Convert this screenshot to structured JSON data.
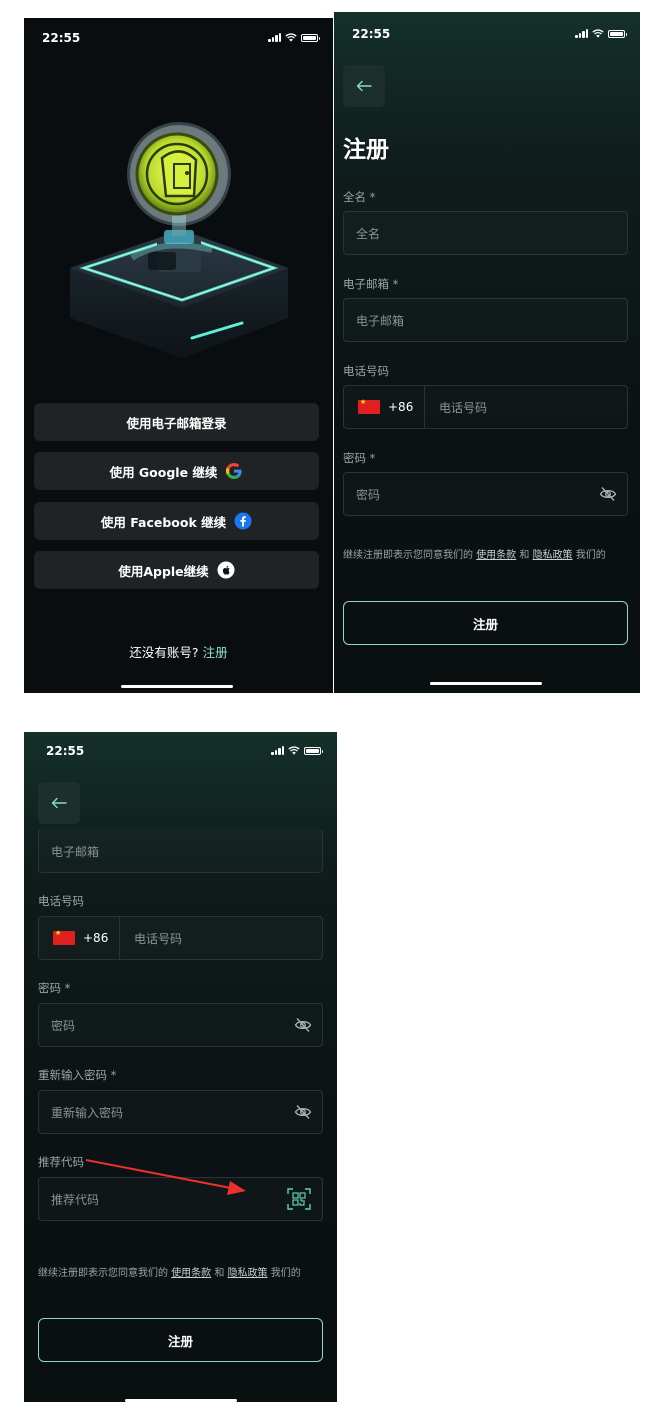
{
  "phone1": {
    "status": {
      "time": "22:55"
    },
    "buttons": [
      {
        "label": "使用电子邮箱登录",
        "icon": ""
      },
      {
        "label": "使用 Google 继续",
        "icon": "google-icon"
      },
      {
        "label": "使用 Facebook 继续",
        "icon": "facebook-icon"
      },
      {
        "label": "使用Apple继续",
        "icon": "apple-icon"
      }
    ],
    "signup_prompt": "还没有账号?",
    "signup_link": "注册"
  },
  "phone2": {
    "status": {
      "time": "22:55"
    },
    "title": "注册",
    "fields": {
      "fullname": {
        "label": "全名 *",
        "placeholder": "全名"
      },
      "email": {
        "label": "电子邮箱 *",
        "placeholder": "电子邮箱"
      },
      "phone": {
        "label": "电话号码",
        "code": "+86",
        "placeholder": "电话号码"
      },
      "password": {
        "label": "密码 *",
        "placeholder": "密码"
      }
    },
    "terms": {
      "prefix": "继续注册即表示您同意我们的",
      "terms_link": "使用条款",
      "and": "和",
      "privacy_link": "隐私政策",
      "suffix": "我们的"
    },
    "submit": "注册"
  },
  "phone3": {
    "status": {
      "time": "22:55"
    },
    "fields": {
      "email": {
        "placeholder": "电子邮箱"
      },
      "phone": {
        "label": "电话号码",
        "code": "+86",
        "placeholder": "电话号码"
      },
      "password": {
        "label": "密码 *",
        "placeholder": "密码"
      },
      "confirm": {
        "label": "重新输入密码 *",
        "placeholder": "重新输入密码"
      },
      "referral": {
        "label": "推荐代码",
        "placeholder": "推荐代码"
      }
    },
    "terms": {
      "prefix": "继续注册即表示您同意我们的",
      "terms_link": "使用条款",
      "and": "和",
      "privacy_link": "隐私政策",
      "suffix": "我们的"
    },
    "submit": "注册"
  },
  "colors": {
    "accent": "#8fe3c6",
    "annotation_arrow": "#e8322b"
  }
}
